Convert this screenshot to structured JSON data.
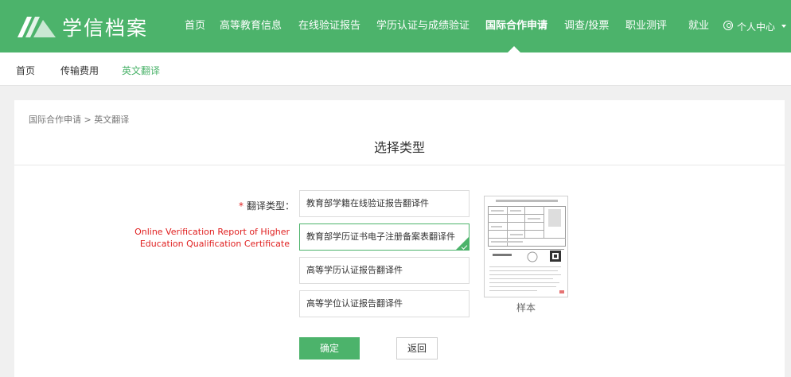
{
  "header": {
    "logo_text": "学信档案",
    "nav": [
      {
        "label": "首页"
      },
      {
        "label": "高等教育信息"
      },
      {
        "label": "在线验证报告"
      },
      {
        "label": "学历认证与成绩验证"
      },
      {
        "label": "国际合作申请",
        "active": true
      },
      {
        "label": "调查/投票"
      },
      {
        "label": "职业测评"
      },
      {
        "label": "就业"
      }
    ],
    "user_menu_label": "个人中心",
    "brand_color": "#4cb36b"
  },
  "subnav": {
    "items": [
      {
        "label": "首页"
      },
      {
        "label": "传输费用"
      },
      {
        "label": "英文翻译",
        "active": true
      }
    ]
  },
  "main": {
    "breadcrumb": "国际合作申请 > 英文翻译",
    "title": "选择类型",
    "field_label": "翻译类型：",
    "required_mark": "*",
    "annotation": "Online Verification Report of Higher Education Qualification Certificate",
    "options": [
      {
        "label": "教育部学籍在线验证报告翻译件"
      },
      {
        "label": "教育部学历证书电子注册备案表翻译件",
        "selected": true
      },
      {
        "label": "高等学历认证报告翻译件"
      },
      {
        "label": "高等学位认证报告翻译件"
      }
    ],
    "sample_caption": "样本",
    "confirm_label": "确定",
    "back_label": "返回"
  }
}
